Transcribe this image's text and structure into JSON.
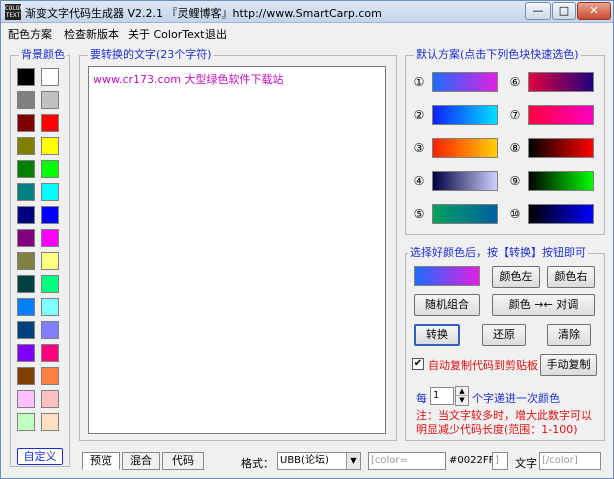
{
  "window": {
    "title": "渐变文字代码生成器 V2.2.1 『灵鲤博客』http://www.SmartCarp.com",
    "icon_text": "COLOR TEXT",
    "controls": {
      "minimize": "—",
      "maximize": "□",
      "close": "✕"
    }
  },
  "menu": [
    "配色方案",
    "检查新版本",
    "关于 ColorText",
    "退出"
  ],
  "bg_colors": {
    "label": "背景颜色",
    "custom_button": "自定义",
    "swatches": [
      [
        "#000000",
        "#ffffff"
      ],
      [
        "#808080",
        "#c0c0c0"
      ],
      [
        "#800000",
        "#ff0000"
      ],
      [
        "#808000",
        "#ffff00"
      ],
      [
        "#008000",
        "#00ff00"
      ],
      [
        "#008080",
        "#00ffff"
      ],
      [
        "#000080",
        "#0000ff"
      ],
      [
        "#800080",
        "#ff00ff"
      ],
      [
        "#808040",
        "#ffff80"
      ],
      [
        "#004040",
        "#00ff80"
      ],
      [
        "#0080ff",
        "#80ffff"
      ],
      [
        "#004080",
        "#8080ff"
      ],
      [
        "#8000ff",
        "#ff0080"
      ],
      [
        "#804000",
        "#ff8040"
      ],
      [
        "#ffc0ff",
        "#ffc0c0"
      ],
      [
        "#c0ffc0",
        "#ffe0c0"
      ]
    ]
  },
  "text_area": {
    "label": "要转换的文字(23个字符)",
    "content": "www.cr173.com 大型绿色软件下载站"
  },
  "presets": {
    "label": "默认方案(点击下列色块快速选色)",
    "items": [
      {
        "num": "①",
        "from": "#1e6cff",
        "to": "#e020e0"
      },
      {
        "num": "⑥",
        "from": "#e00040",
        "to": "#200080"
      },
      {
        "num": "②",
        "from": "#1020ff",
        "to": "#00e0ff"
      },
      {
        "num": "⑦",
        "from": "#ff0040",
        "to": "#ff00c0"
      },
      {
        "num": "③",
        "from": "#ff2000",
        "to": "#ffd000"
      },
      {
        "num": "⑧",
        "from": "#000000",
        "to": "#ff0000"
      },
      {
        "num": "④",
        "from": "#000040",
        "to": "#d0d0ff"
      },
      {
        "num": "⑨",
        "from": "#000000",
        "to": "#00ff00"
      },
      {
        "num": "⑤",
        "from": "#00a060",
        "to": "#0060a0"
      },
      {
        "num": "⑩",
        "from": "#000000",
        "to": "#0000ff"
      }
    ]
  },
  "convert_panel": {
    "label": "选择好颜色后，按【转换】按钮即可",
    "preview_from": "#1e6cff",
    "preview_to": "#e020e0",
    "left_color_btn": "颜色左",
    "right_color_btn": "颜色右",
    "random_btn": "随机组合",
    "swap_btn": "颜色 →← 对调",
    "convert_btn": "转换",
    "restore_btn": "还原",
    "clear_btn": "清除",
    "auto_copy_label": "自动复制代码到剪贴板",
    "auto_copy_checked": "✔",
    "manual_copy_btn": "手动复制",
    "step_prefix": "每",
    "step_value": "1",
    "step_suffix": "个字递进一次颜色",
    "note": "注：当文字较多时，增大此数字可以明显减少代码长度(范围：1-100)"
  },
  "bottom": {
    "tabs": [
      "预览",
      "混合",
      "代码"
    ],
    "format_label": "格式：",
    "format_value": "UBB(论坛)",
    "tag_open": "[color=",
    "hex_value": "#0022FF",
    "tag_close_bracket": "]",
    "text_label": "文字",
    "tag_end": "[/color]"
  }
}
